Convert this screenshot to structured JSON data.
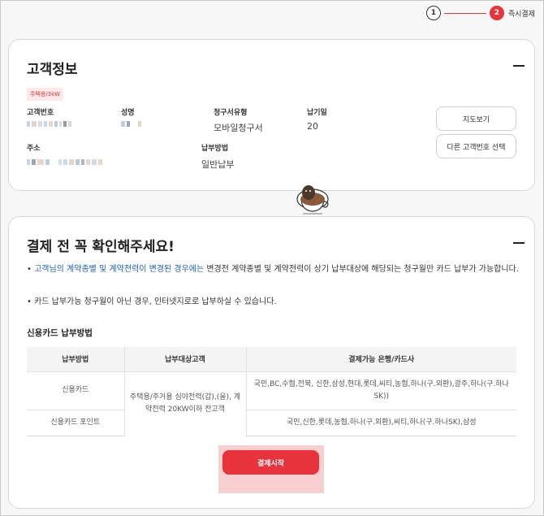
{
  "stepper": {
    "step1_number": "1",
    "step2_number": "2",
    "step2_label": "즉시결제",
    "accent_color": "#e8323c"
  },
  "customer_info": {
    "title": "고객정보",
    "tag": "주택용/3kW",
    "customer_number_label": "고객번호",
    "name_label": "성명",
    "bill_type_label": "청구서유형",
    "bill_type_value": "모바일청구서",
    "due_day_label": "납기일",
    "due_day_value": "20",
    "address_label": "주소",
    "payment_method_label": "납부방법",
    "payment_method_value": "일반납부",
    "map_button": "지도보기",
    "select_other_button": "다른 고객번호 선택"
  },
  "confirm": {
    "title": "결제 전 꼭 확인해주세요!",
    "notice1_highlight": "고객님의 계약종별 및 계약전력이 변경된 경우에는",
    "notice1_rest": " 변경전 계약종별 및 계약전력이 상기 납부대상에 해당되는 청구월만 카드 납부가 가능합니다.",
    "notice2": "카드 납부가능 청구월이 아닌 경우, 인터넷지로로 납부하실 수 있습니다.",
    "subtitle": "신용카드 납부방법",
    "table_headers": [
      "납부방법",
      "납부대상고객",
      "결제가능 은행/카드사"
    ],
    "rows": [
      {
        "method": "신용카드",
        "banks": "국민,BC,수협,전북, 신한,삼성,현대,롯데,씨티,농협,하나(구.외환),광주,하나(구.하나SK))"
      },
      {
        "method": "신용카드 포인트",
        "banks": "국민,신한,롯데,농협,하나(구.외환),씨티,하나(구.하나SK),삼성"
      }
    ],
    "target_customers": "주택용/주거용 심야전력(갑),(을), 계약전력 20KW이하 전고객",
    "pay_button": "결제시작"
  }
}
